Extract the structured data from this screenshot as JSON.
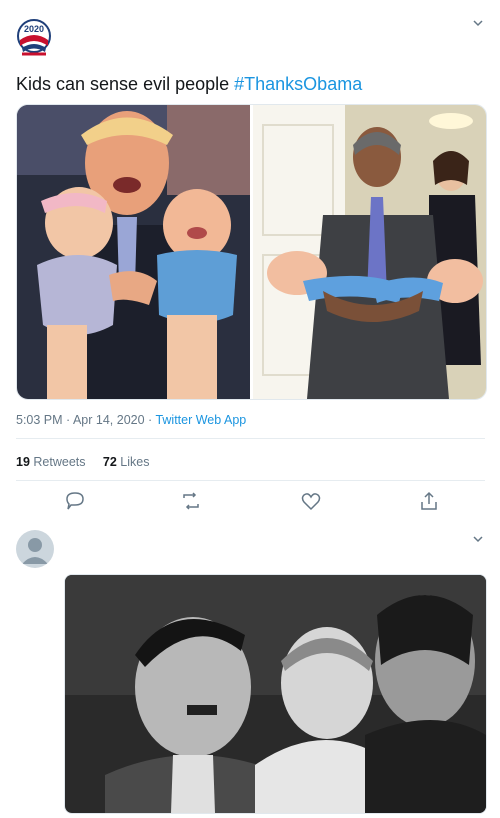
{
  "tweet": {
    "avatar_logo": "2020 campaign logo",
    "menu_icon": "chevron-down-icon",
    "text_plain": "Kids can sense evil people ",
    "hashtag": "#ThanksObama",
    "timestamp": "5:03 PM · Apr 14, 2020 · ",
    "source_app": "Twitter Web App",
    "retweets_count": "19",
    "retweets_label": "Retweets",
    "likes_count": "72",
    "likes_label": "Likes",
    "actions": [
      "reply-icon",
      "retweet-icon",
      "like-icon",
      "share-icon"
    ],
    "logo_text": "2020"
  },
  "reply": {
    "avatar": "default-avatar-icon",
    "menu_icon": "chevron-down-icon"
  },
  "colors": {
    "link": "#1b95e0",
    "text": "#14171a",
    "muted": "#657786",
    "border": "#e6ecf0"
  }
}
